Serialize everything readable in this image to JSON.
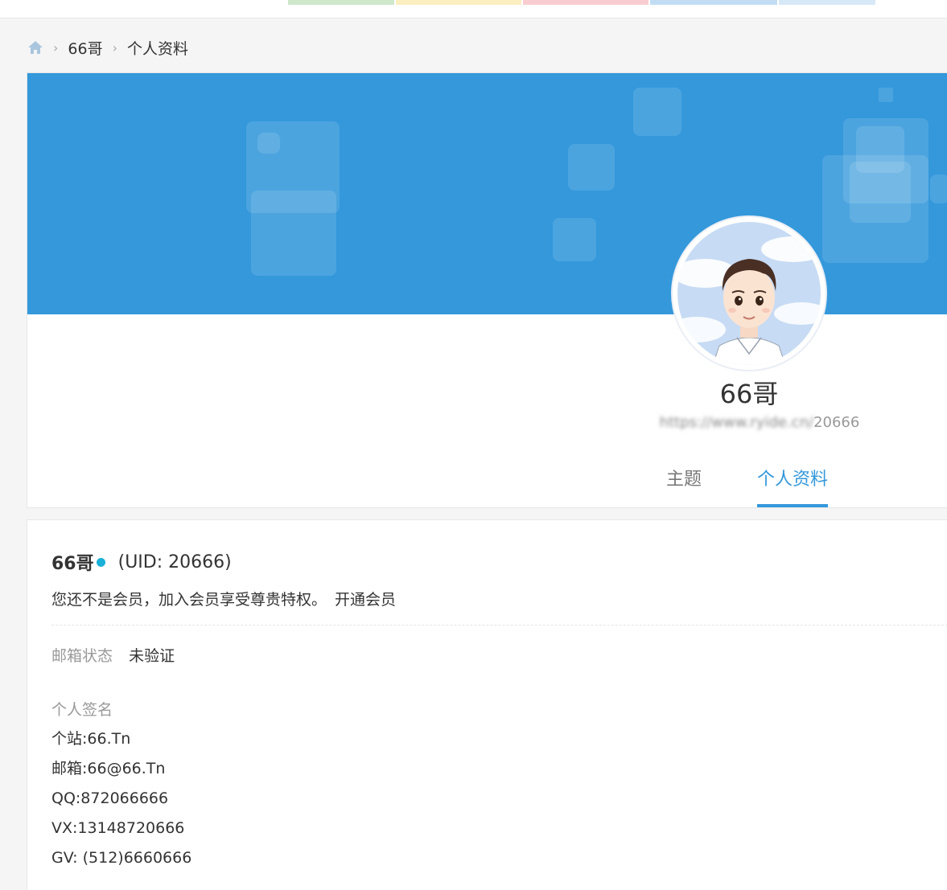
{
  "breadcrumb": {
    "items": [
      "66哥",
      "个人资料"
    ]
  },
  "profile": {
    "name": "66哥",
    "url_visible_suffix": "20666",
    "url_blurred": "https://www.ryide.cn/"
  },
  "tabs": [
    {
      "label": "主题",
      "active": false
    },
    {
      "label": "个人资料",
      "active": true
    }
  ],
  "info": {
    "username": "66哥",
    "uid": "(UID: 20666)",
    "member_text": "您还不是会员，加入会员享受尊贵特权。",
    "member_link": "开通会员",
    "email_status_label": "邮箱状态",
    "email_status_value": "未验证",
    "signature_label": "个人签名",
    "signature_lines": [
      "个站:66.Tn",
      "邮箱:66@66.Tn",
      "QQ:872066666",
      "VX:13148720666",
      "GV: (512)6660666"
    ]
  },
  "colors": {
    "accent": "#3498db",
    "online_dot": "#1ab0d8"
  },
  "icons": {
    "home": "home-icon",
    "separator": "chevron-right-icon"
  }
}
